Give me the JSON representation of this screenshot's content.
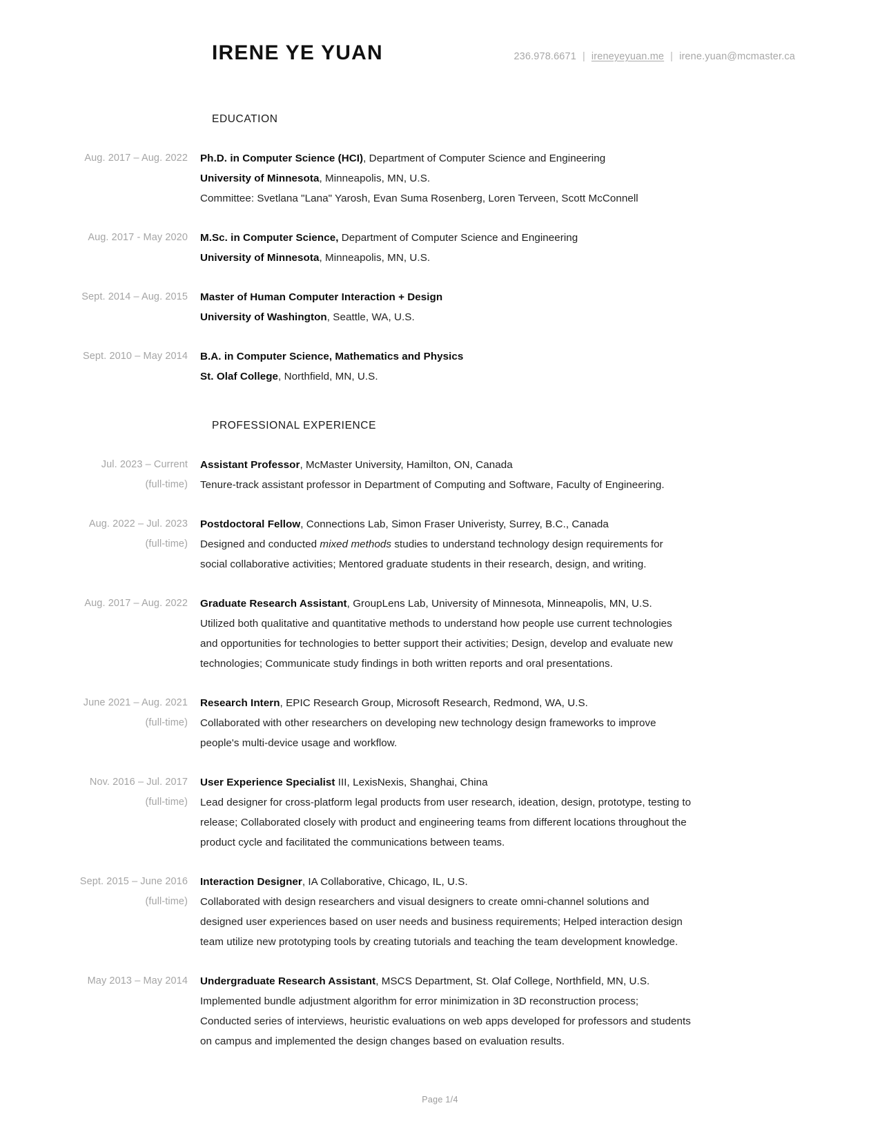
{
  "header": {
    "name": "IRENE YE YUAN",
    "phone": "236.978.6671",
    "separator": "|",
    "website": "ireneyeyuan.me",
    "email": "irene.yuan@mcmaster.ca"
  },
  "sections": {
    "education": {
      "title": "EDUCATION",
      "entries": [
        {
          "dates": "Aug. 2017 – Aug. 2022",
          "fulltime": "",
          "lines": [
            {
              "bold": "Ph.D. in Computer Science (HCI)",
              "rest": ", Department of Computer Science and Engineering"
            },
            {
              "bold": "University of Minnesota",
              "rest": ", Minneapolis, MN, U.S."
            },
            {
              "bold": "",
              "rest": "Committee: Svetlana \"Lana\" Yarosh, Evan Suma Rosenberg, Loren Terveen, Scott McConnell"
            }
          ]
        },
        {
          "dates": "Aug. 2017 - May 2020",
          "fulltime": "",
          "lines": [
            {
              "bold": "M.Sc. in Computer Science,",
              "rest": " Department of Computer Science and Engineering"
            },
            {
              "bold": "University of Minnesota",
              "rest": ", Minneapolis, MN, U.S."
            }
          ]
        },
        {
          "dates": "Sept. 2014 – Aug. 2015",
          "fulltime": "",
          "lines": [
            {
              "bold": "Master of Human Computer Interaction + Design",
              "rest": ""
            },
            {
              "bold": "University of Washington",
              "rest": ", Seattle, WA, U.S."
            }
          ]
        },
        {
          "dates": "Sept. 2010 – May 2014",
          "fulltime": "",
          "lines": [
            {
              "bold": "B.A. in Computer Science, Mathematics and Physics",
              "rest": ""
            },
            {
              "bold": "St. Olaf College",
              "rest": ", Northfield, MN, U.S."
            }
          ]
        }
      ]
    },
    "experience": {
      "title": "PROFESSIONAL EXPERIENCE",
      "entries": [
        {
          "dates": "Jul. 2023 – Current",
          "fulltime": "(full-time)",
          "lines": [
            {
              "bold": "Assistant Professor",
              "rest": ", McMaster University, Hamilton, ON, Canada"
            },
            {
              "bold": "",
              "rest": "Tenure-track assistant professor in Department of Computing and Software, Faculty of Engineering."
            }
          ]
        },
        {
          "dates": "Aug. 2022 – Jul. 2023",
          "fulltime": "(full-time)",
          "lines": [
            {
              "bold": "Postdoctoral Fellow",
              "rest": ", Connections Lab, Simon Fraser Univeristy, Surrey, B.C., Canada"
            },
            {
              "bold": "",
              "rest": "Designed and conducted ",
              "italic": "mixed methods",
              "tail": " studies to understand technology design requirements for"
            },
            {
              "bold": "",
              "rest": "social collaborative activities; Mentored graduate students in their research, design, and writing."
            }
          ]
        },
        {
          "dates": "Aug. 2017 – Aug. 2022",
          "fulltime": "",
          "lines": [
            {
              "bold": "Graduate Research Assistant",
              "rest": ", GroupLens Lab, University of Minnesota, Minneapolis, MN, U.S."
            },
            {
              "bold": "",
              "rest": "Utilized both qualitative and quantitative methods to understand how people use current technologies"
            },
            {
              "bold": "",
              "rest": "and opportunities for technologies to better support their activities; Design, develop and evaluate new"
            },
            {
              "bold": "",
              "rest": "technologies; Communicate study findings in both written reports and oral presentations."
            }
          ]
        },
        {
          "dates": "June 2021 – Aug. 2021",
          "fulltime": "(full-time)",
          "lines": [
            {
              "bold": "Research Intern",
              "rest": ", EPIC Research Group, Microsoft Research, Redmond, WA, U.S."
            },
            {
              "bold": "",
              "rest": "Collaborated with other researchers on developing new technology design frameworks to improve"
            },
            {
              "bold": "",
              "rest": "people's multi-device usage and workflow."
            }
          ]
        },
        {
          "dates": "Nov. 2016 – Jul. 2017",
          "fulltime": "(full-time)",
          "lines": [
            {
              "bold": "User Experience Specialist",
              "rest": " III, LexisNexis, Shanghai, China"
            },
            {
              "bold": "",
              "rest": "Lead designer for cross-platform legal products from user research, ideation, design, prototype, testing to"
            },
            {
              "bold": "",
              "rest": "release; Collaborated closely with product and engineering teams from different locations throughout the"
            },
            {
              "bold": "",
              "rest": "product cycle and facilitated the communications between teams."
            }
          ]
        },
        {
          "dates": "Sept. 2015 – June 2016",
          "fulltime": "(full-time)",
          "lines": [
            {
              "bold": "Interaction Designer",
              "rest": ", IA Collaborative, Chicago, IL, U.S."
            },
            {
              "bold": "",
              "rest": "Collaborated with design researchers and visual designers to create omni-channel solutions and"
            },
            {
              "bold": "",
              "rest": "designed user experiences based on user needs and business requirements; Helped interaction design"
            },
            {
              "bold": "",
              "rest": "team utilize new prototyping tools by creating tutorials and teaching the team development knowledge."
            }
          ]
        },
        {
          "dates": "May 2013 – May 2014",
          "fulltime": "",
          "lines": [
            {
              "bold": "Undergraduate Research Assistant",
              "rest": ", MSCS Department, St. Olaf College, Northfield, MN, U.S."
            },
            {
              "bold": "",
              "rest": "Implemented bundle adjustment algorithm for error minimization in 3D reconstruction process;"
            },
            {
              "bold": "",
              "rest": "Conducted series of interviews, heuristic evaluations on web apps developed for professors and students"
            },
            {
              "bold": "",
              "rest": "on campus and implemented the design changes based on evaluation results."
            }
          ]
        }
      ]
    }
  },
  "footer": {
    "page_label": "Page 1/4"
  }
}
